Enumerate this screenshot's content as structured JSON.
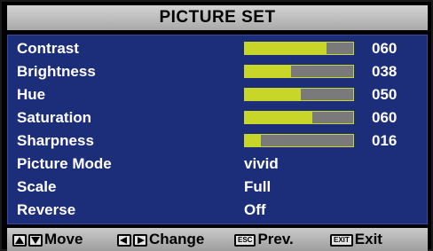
{
  "menu": {
    "title": "PICTURE SET",
    "items": [
      {
        "label": "Contrast",
        "type": "slider",
        "value": "060",
        "fraction": 0.75
      },
      {
        "label": "Brightness",
        "type": "slider",
        "value": "038",
        "fraction": 0.43
      },
      {
        "label": "Hue",
        "type": "slider",
        "value": "050",
        "fraction": 0.52
      },
      {
        "label": "Saturation",
        "type": "slider",
        "value": "060",
        "fraction": 0.62
      },
      {
        "label": "Sharpness",
        "type": "slider",
        "value": "016",
        "fraction": 0.15
      },
      {
        "label": "Picture Mode",
        "type": "option",
        "value": "vivid"
      },
      {
        "label": "Scale",
        "type": "option",
        "value": "Full"
      },
      {
        "label": "Reverse",
        "type": "option",
        "value": "Off"
      }
    ]
  },
  "footer": {
    "move_label": "Move",
    "change_label": "Change",
    "esc_key": "ESC",
    "prev_label": "Prev.",
    "exit_key": "EXIT",
    "exit_label": "Exit",
    "icons": [
      "up-down-arrows-icon",
      "left-right-arrows-icon"
    ]
  },
  "colors": {
    "panel": "#1c2e7a",
    "title_bar": "#bfbfbf",
    "slider_fill": "#c8d62a",
    "slider_track": "#7a7a7a",
    "text": "#ffffff"
  }
}
